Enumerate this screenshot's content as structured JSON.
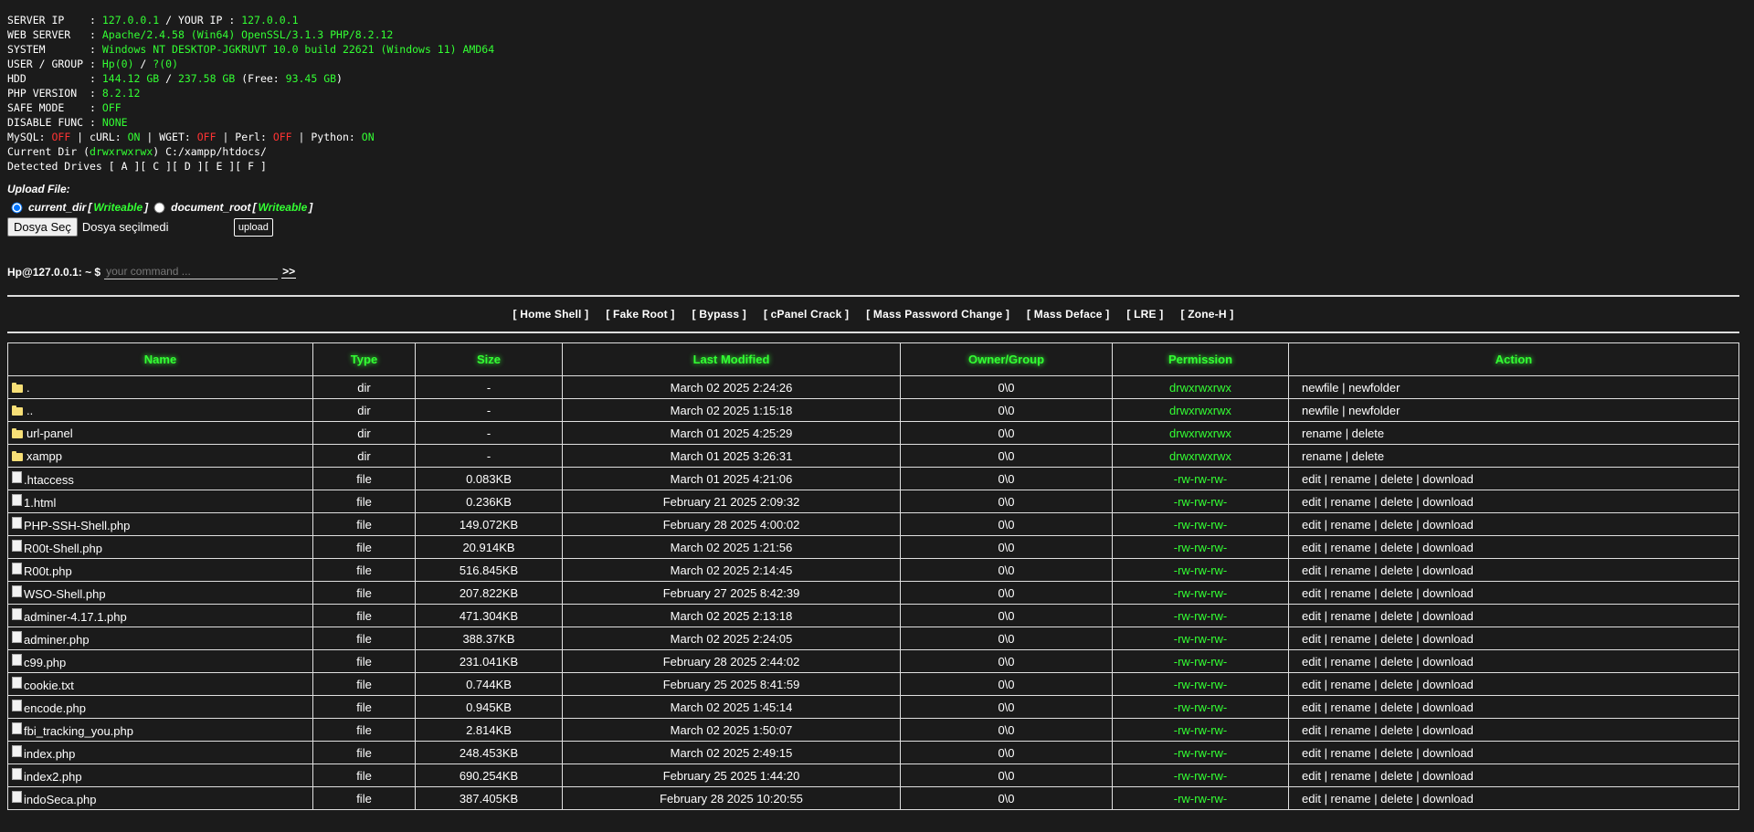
{
  "info": {
    "server_ip_label": "SERVER IP    : ",
    "server_ip": "127.0.0.1",
    "your_ip_label": " / YOUR IP : ",
    "your_ip": "127.0.0.1",
    "web_server_label": "WEB SERVER   : ",
    "web_server": "Apache/2.4.58 (Win64) OpenSSL/3.1.3 PHP/8.2.12",
    "system_label": "SYSTEM       : ",
    "system": "Windows NT DESKTOP-JGKRUVT 10.0 build 22621 (Windows 11) AMD64",
    "user_label": "USER / GROUP : ",
    "user": "Hp",
    "user_id": "(0)",
    "group_sep": " / ",
    "group": "?",
    "group_id": "(0)",
    "hdd_label": "HDD          : ",
    "hdd_used": "144.12 GB",
    "hdd_sep": " / ",
    "hdd_total": "237.58 GB",
    "hdd_free_label": " (Free: ",
    "hdd_free": "93.45 GB",
    "hdd_close": ")",
    "php_label": "PHP VERSION  : ",
    "php": "8.2.12",
    "safe_label": "SAFE MODE    : ",
    "safe": "OFF",
    "disable_label": "DISABLE FUNC : ",
    "disable": "NONE",
    "mysql_label": "MySQL: ",
    "mysql": "OFF",
    "curl_label": " | cURL: ",
    "curl": "ON",
    "wget_label": " | WGET: ",
    "wget": "OFF",
    "perl_label": " | Perl: ",
    "perl": "OFF",
    "python_label": " | Python: ",
    "python": "ON",
    "curdir_label": "Current Dir (",
    "curdir_perm": "drwxrwxrwx",
    "curdir_path": ") C:/xampp/htdocs/",
    "drives": "Detected Drives [ A ][ C ][ D ][ E ][ F ]"
  },
  "upload": {
    "title": "Upload File:",
    "opt1_label": "current_dir",
    "opt1_open": " [ ",
    "opt1_status": "Writeable",
    "opt1_close": " ]",
    "opt2_label": "document_root",
    "opt2_open": " [ ",
    "opt2_status": "Writeable",
    "opt2_close": " ]",
    "choose_label": "Dosya Seç",
    "no_file": "Dosya seçilmedi",
    "upload_label": "upload"
  },
  "command": {
    "prompt": "Hp@127.0.0.1: ~ $",
    "placeholder": "your command ...",
    "go_label": ">>"
  },
  "menu": [
    "[ Home Shell ]",
    "[ Fake Root ]",
    "[ Bypass ]",
    "[ cPanel Crack ]",
    "[ Mass Password Change ]",
    "[ Mass Deface ]",
    "[ LRE ]",
    "[ Zone-H ]"
  ],
  "table": {
    "headers": [
      "Name",
      "Type",
      "Size",
      "Last Modified",
      "Owner/Group",
      "Permission",
      "Action"
    ],
    "rows": [
      {
        "name": ".",
        "icon": "folder-icon",
        "type": "dir",
        "size": "-",
        "modified": "March 02 2025 2:24:26",
        "owner": "0\\0",
        "perm": "drwxrwxrwx",
        "action": "newfile | newfolder"
      },
      {
        "name": "..",
        "icon": "folder-icon",
        "type": "dir",
        "size": "-",
        "modified": "March 02 2025 1:15:18",
        "owner": "0\\0",
        "perm": "drwxrwxrwx",
        "action": "newfile | newfolder"
      },
      {
        "name": "url-panel",
        "icon": "folder-icon",
        "type": "dir",
        "size": "-",
        "modified": "March 01 2025 4:25:29",
        "owner": "0\\0",
        "perm": "drwxrwxrwx",
        "action": "rename | delete"
      },
      {
        "name": "xampp",
        "icon": "folder-icon",
        "type": "dir",
        "size": "-",
        "modified": "March 01 2025 3:26:31",
        "owner": "0\\0",
        "perm": "drwxrwxrwx",
        "action": "rename | delete"
      },
      {
        "name": ".htaccess",
        "icon": "file-icon",
        "type": "file",
        "size": "0.083KB",
        "modified": "March 01 2025 4:21:06",
        "owner": "0\\0",
        "perm": "-rw-rw-rw-",
        "action": "edit | rename | delete | download"
      },
      {
        "name": "1.html",
        "icon": "file-icon",
        "type": "file",
        "size": "0.236KB",
        "modified": "February 21 2025 2:09:32",
        "owner": "0\\0",
        "perm": "-rw-rw-rw-",
        "action": "edit | rename | delete | download"
      },
      {
        "name": "PHP-SSH-Shell.php",
        "icon": "file-icon",
        "type": "file",
        "size": "149.072KB",
        "modified": "February 28 2025 4:00:02",
        "owner": "0\\0",
        "perm": "-rw-rw-rw-",
        "action": "edit | rename | delete | download"
      },
      {
        "name": "R00t-Shell.php",
        "icon": "file-icon",
        "type": "file",
        "size": "20.914KB",
        "modified": "March 02 2025 1:21:56",
        "owner": "0\\0",
        "perm": "-rw-rw-rw-",
        "action": "edit | rename | delete | download"
      },
      {
        "name": "R00t.php",
        "icon": "file-icon",
        "type": "file",
        "size": "516.845KB",
        "modified": "March 02 2025 2:14:45",
        "owner": "0\\0",
        "perm": "-rw-rw-rw-",
        "action": "edit | rename | delete | download"
      },
      {
        "name": "WSO-Shell.php",
        "icon": "file-icon",
        "type": "file",
        "size": "207.822KB",
        "modified": "February 27 2025 8:42:39",
        "owner": "0\\0",
        "perm": "-rw-rw-rw-",
        "action": "edit | rename | delete | download"
      },
      {
        "name": "adminer-4.17.1.php",
        "icon": "file-icon",
        "type": "file",
        "size": "471.304KB",
        "modified": "March 02 2025 2:13:18",
        "owner": "0\\0",
        "perm": "-rw-rw-rw-",
        "action": "edit | rename | delete | download"
      },
      {
        "name": "adminer.php",
        "icon": "file-icon",
        "type": "file",
        "size": "388.37KB",
        "modified": "March 02 2025 2:24:05",
        "owner": "0\\0",
        "perm": "-rw-rw-rw-",
        "action": "edit | rename | delete | download"
      },
      {
        "name": "c99.php",
        "icon": "file-icon",
        "type": "file",
        "size": "231.041KB",
        "modified": "February 28 2025 2:44:02",
        "owner": "0\\0",
        "perm": "-rw-rw-rw-",
        "action": "edit | rename | delete | download"
      },
      {
        "name": "cookie.txt",
        "icon": "file-icon",
        "type": "file",
        "size": "0.744KB",
        "modified": "February 25 2025 8:41:59",
        "owner": "0\\0",
        "perm": "-rw-rw-rw-",
        "action": "edit | rename | delete | download"
      },
      {
        "name": "encode.php",
        "icon": "file-icon",
        "type": "file",
        "size": "0.945KB",
        "modified": "March 02 2025 1:45:14",
        "owner": "0\\0",
        "perm": "-rw-rw-rw-",
        "action": "edit | rename | delete | download"
      },
      {
        "name": "fbi_tracking_you.php",
        "icon": "file-icon",
        "type": "file",
        "size": "2.814KB",
        "modified": "March 02 2025 1:50:07",
        "owner": "0\\0",
        "perm": "-rw-rw-rw-",
        "action": "edit | rename | delete | download"
      },
      {
        "name": "index.php",
        "icon": "file-icon",
        "type": "file",
        "size": "248.453KB",
        "modified": "March 02 2025 2:49:15",
        "owner": "0\\0",
        "perm": "-rw-rw-rw-",
        "action": "edit | rename | delete | download"
      },
      {
        "name": "index2.php",
        "icon": "file-icon",
        "type": "file",
        "size": "690.254KB",
        "modified": "February 25 2025 1:44:20",
        "owner": "0\\0",
        "perm": "-rw-rw-rw-",
        "action": "edit | rename | delete | download"
      },
      {
        "name": "indoSeca.php",
        "icon": "file-icon",
        "type": "file",
        "size": "387.405KB",
        "modified": "February 28 2025 10:20:55",
        "owner": "0\\0",
        "perm": "-rw-rw-rw-",
        "action": "edit | rename | delete | download"
      }
    ]
  },
  "colors": {
    "background": "#1b1b1b",
    "accent_green": "#33ff33",
    "off_red": "#ff3333",
    "folder_yellow": "#f7df77"
  }
}
